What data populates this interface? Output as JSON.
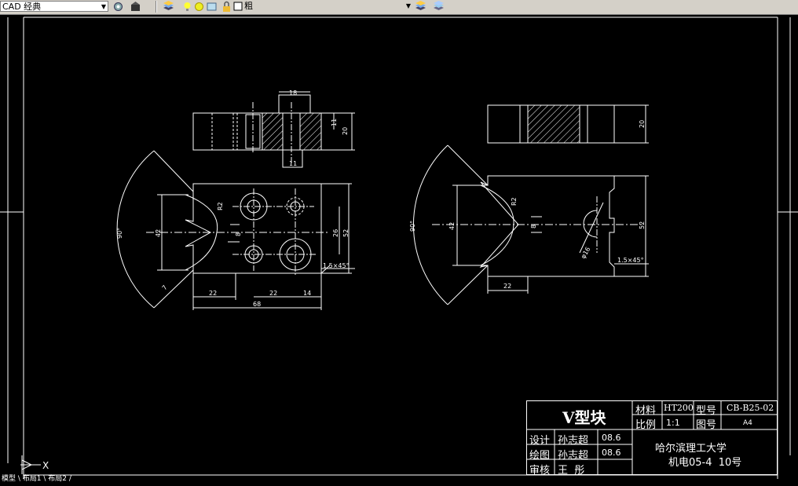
{
  "toolbar": {
    "workspace_value": "CAD 经典",
    "layer_value": "粗",
    "icons": [
      "workspace-settings-icon",
      "workspace-icon",
      "layer-manager-icon",
      "lightbulb-icon",
      "sun-icon",
      "freeze-icon",
      "lock-icon",
      "color-swatch-icon",
      "layer-previous-icon",
      "layer-state-icon"
    ]
  },
  "drawing": {
    "left_view": {
      "top_dims": {
        "width_top": "18",
        "height_right": "20",
        "small_right": "11",
        "width_bottom": "11"
      },
      "front_dims": {
        "angle": "90°",
        "radius_left": "42",
        "radius_r": "R2",
        "vgap": "8",
        "height_26": "26",
        "height_52": "52",
        "chamfer": "1.5×45°",
        "d22a": "22",
        "d22b": "22",
        "d14": "14",
        "d68": "68",
        "d7": "7"
      }
    },
    "right_view": {
      "top_dims": {
        "height_right": "20"
      },
      "front_dims": {
        "angle": "90°",
        "radius_left": "42",
        "radius_r": "R2",
        "vgap": "8",
        "height_52": "52",
        "chamfer": "1.5×45°",
        "d22": "22",
        "phi16": "φ16"
      }
    }
  },
  "title_block": {
    "part_name": "V型块",
    "material_label": "材料",
    "material_value": "HT200",
    "model_label": "型号",
    "model_value": "CB-B25-02",
    "scale_label": "比例",
    "scale_value": "1:1",
    "drawing_no_label": "图号",
    "drawing_no_value": "A4",
    "design_label": "设计",
    "designer": "孙志超",
    "design_date": "08.6",
    "draw_label": "绘图",
    "drafter": "孙志超",
    "draw_date": "08.6",
    "review_label": "审核",
    "reviewer": "王  彤",
    "school": "哈尔滨理工大学",
    "class_info": "机电05-4  10号"
  },
  "ucs": {
    "x_label": "X"
  },
  "status_text": "模型 \\ 布局1 \\ 布局2 /"
}
